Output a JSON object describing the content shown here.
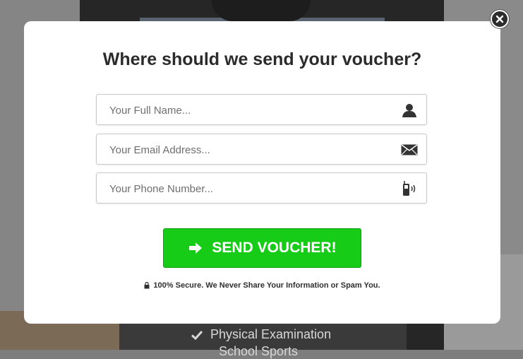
{
  "background": {
    "list_items": [
      "Physical Examination",
      "School Sports"
    ]
  },
  "modal": {
    "title": "Where should we send your voucher?",
    "fields": [
      {
        "placeholder": "Your Full Name...",
        "icon": "user-icon"
      },
      {
        "placeholder": "Your Email Address...",
        "icon": "envelope-icon"
      },
      {
        "placeholder": "Your Phone Number...",
        "icon": "mobile-phone-icon"
      }
    ],
    "submit": {
      "label": "SEND VOUCHER!",
      "icon": "arrow-right-icon",
      "color": "#17cc17"
    },
    "secure_note": "100% Secure. We Never Share Your Information or Spam You.",
    "close_icon": "close-icon"
  }
}
